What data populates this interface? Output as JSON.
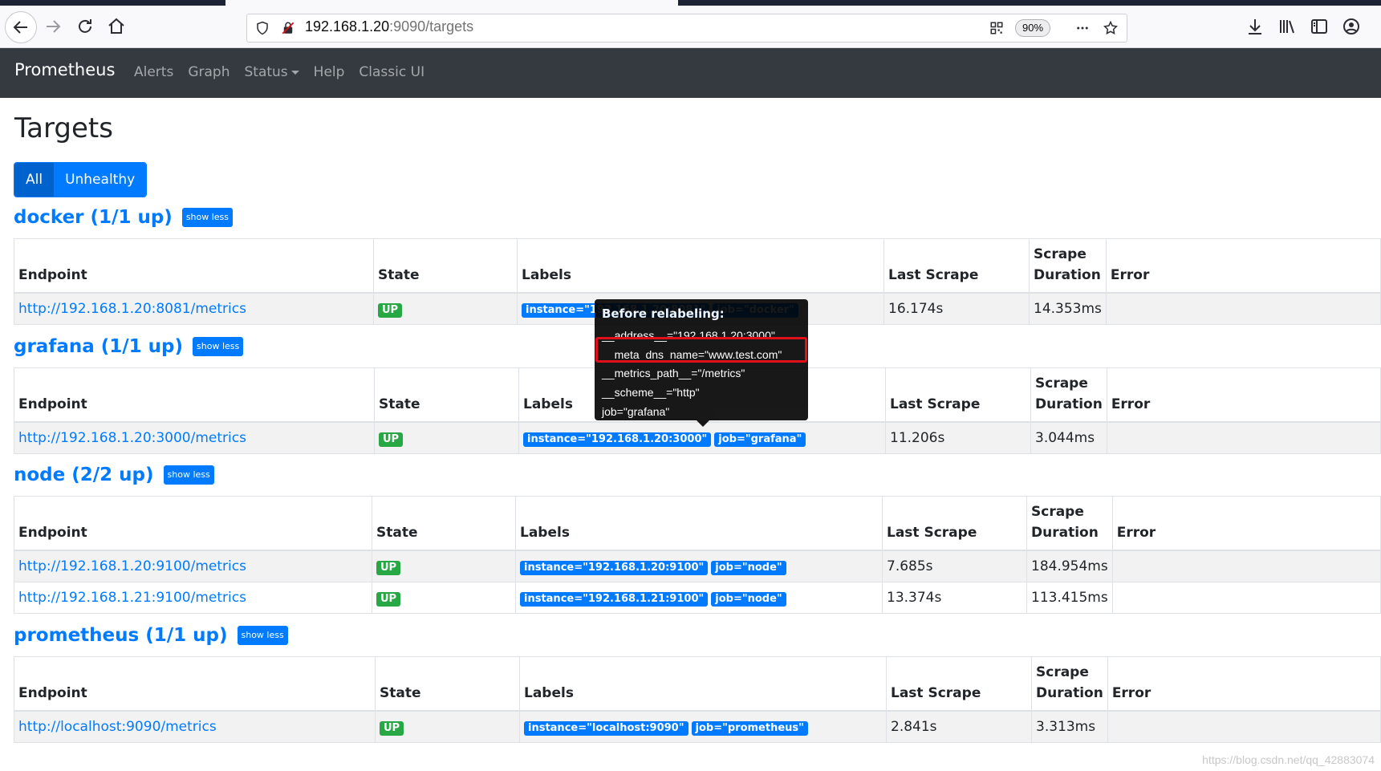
{
  "browser": {
    "url_host": "192.168.1.20",
    "url_rest": ":9090/targets",
    "zoom": "90%"
  },
  "navbar": {
    "brand": "Prometheus",
    "links": [
      "Alerts",
      "Graph",
      "Status",
      "Help",
      "Classic UI"
    ]
  },
  "page": {
    "title": "Targets",
    "filter_all": "All",
    "filter_unhealthy": "Unhealthy"
  },
  "headers": {
    "endpoint": "Endpoint",
    "state": "State",
    "labels": "Labels",
    "last_scrape": "Last Scrape",
    "scrape": "Scrape",
    "duration": "Duration",
    "error": "Error"
  },
  "show_less": "show less",
  "sections": [
    {
      "title": "docker (1/1 up)",
      "rows": [
        {
          "endpoint": "http://192.168.1.20:8081/metrics",
          "state": "UP",
          "labels": [
            "instance=\"192.168.1.20:8081\"",
            "job=\"docker\""
          ],
          "last_scrape": "16.174s",
          "duration": "14.353ms",
          "error": ""
        }
      ]
    },
    {
      "title": "grafana (1/1 up)",
      "rows": [
        {
          "endpoint": "http://192.168.1.20:3000/metrics",
          "state": "UP",
          "labels": [
            "instance=\"192.168.1.20:3000\"",
            "job=\"grafana\""
          ],
          "last_scrape": "11.206s",
          "duration": "3.044ms",
          "error": ""
        }
      ]
    },
    {
      "title": "node (2/2 up)",
      "rows": [
        {
          "endpoint": "http://192.168.1.20:9100/metrics",
          "state": "UP",
          "labels": [
            "instance=\"192.168.1.20:9100\"",
            "job=\"node\""
          ],
          "last_scrape": "7.685s",
          "duration": "184.954ms",
          "error": ""
        },
        {
          "endpoint": "http://192.168.1.21:9100/metrics",
          "state": "UP",
          "labels": [
            "instance=\"192.168.1.21:9100\"",
            "job=\"node\""
          ],
          "last_scrape": "13.374s",
          "duration": "113.415ms",
          "error": ""
        }
      ]
    },
    {
      "title": "prometheus (1/1 up)",
      "rows": [
        {
          "endpoint": "http://localhost:9090/metrics",
          "state": "UP",
          "labels": [
            "instance=\"localhost:9090\"",
            "job=\"prometheus\""
          ],
          "last_scrape": "2.841s",
          "duration": "3.313ms",
          "error": ""
        }
      ]
    }
  ],
  "tooltip": {
    "title": "Before relabeling:",
    "lines": [
      "__address__=\"192.168.1.20:3000\"",
      "__meta_dns_name=\"www.test.com\"",
      "__metrics_path__=\"/metrics\"",
      "__scheme__=\"http\"",
      "job=\"grafana\""
    ]
  },
  "watermark": "https://blog.csdn.net/qq_42883074",
  "colors": {
    "navbar_bg": "#343a40",
    "primary": "#007bff",
    "success": "#28a745",
    "highlight": "#e0101a"
  }
}
